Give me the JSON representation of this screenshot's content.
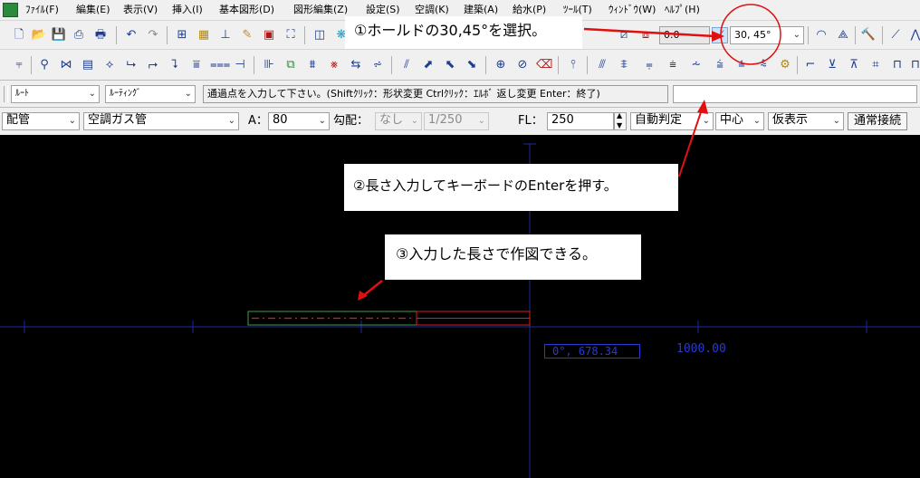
{
  "menu": [
    "ﾌｧｲﾙ(F)",
    "編集(E)",
    "表示(V)",
    "挿入(I)",
    "基本図形(D)",
    "図形編集(Z)",
    "設定(S)",
    "空調(K)",
    "建築(A)",
    "給水(P)",
    "ﾂｰﾙ(T)",
    "ｳｨﾝﾄﾞｳ(W)",
    "ﾍﾙﾌﾟ(H)"
  ],
  "toolbar1": {
    "offset_value": "0.0",
    "hold_angle": "30, 45°"
  },
  "command_bar": {
    "layer": "ﾙｰﾄ",
    "mode": "ﾙｰﾃｨﾝｸﾞ",
    "prompt": "通過点を入力して下さい。(Shiftｸﾘｯｸ：形状変更 Ctrlｸﾘｯｸ：ｴﾙﾎﾞ 返し変更 Enter：終了)",
    "length_input": ""
  },
  "pipe_bar": {
    "category": "配管",
    "system": "空調ガス管",
    "size_label": "A：",
    "size_value": "80",
    "slope_label": "勾配：",
    "slope_value": "なし",
    "slope_ratio": "1/250",
    "fl_label": "FL：",
    "fl_value": "250",
    "auto_judge": "自動判定",
    "center": "中心",
    "display": "仮表示",
    "connect": "通常接続"
  },
  "callouts": {
    "step1": "①ホールドの30,45°を選択。",
    "step2": "②長さ入力してキーボードのEnterを押す。",
    "step3": "③入力した長さで作図できる。"
  },
  "canvas": {
    "angle_length": "0°, 678.34",
    "scale_value": "1000.00"
  },
  "colors": {
    "canvas_bg": "#000000",
    "axis": "#1c2aa0",
    "pipe_drawn": "#3ea043",
    "pipe_preview": "#e11d1d",
    "annotation_red": "#e01010",
    "dim_text": "#2a3ad0"
  }
}
